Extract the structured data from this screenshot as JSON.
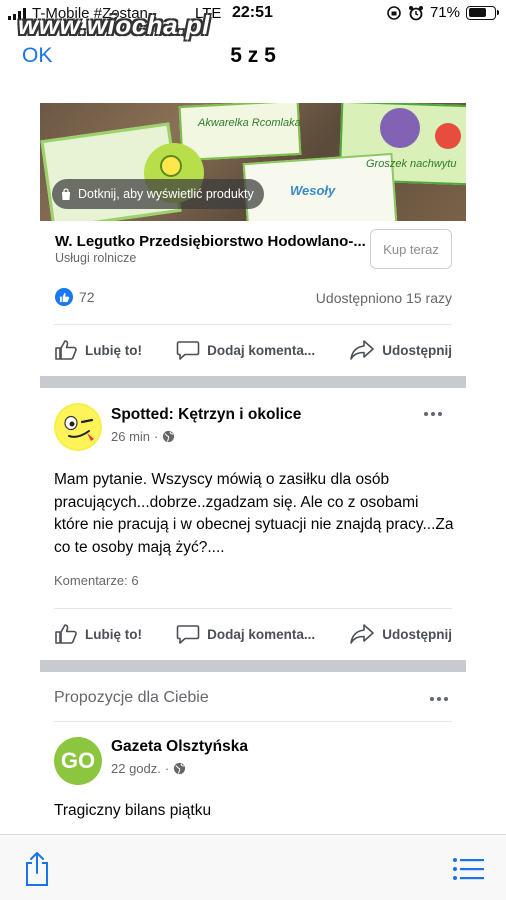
{
  "status": {
    "carrier": "T-Mobile #Zostan",
    "network": "LTE",
    "time": "22:51",
    "battery": "71%",
    "battery_level": 0.71
  },
  "watermark": "www.wiocha.pl",
  "nav": {
    "ok": "OK",
    "title": "5 z 5"
  },
  "ad": {
    "photo_pill": "Dotknij, aby wyświetlić produkty",
    "photo_texts": [
      "Akwarelka Rcomlaka",
      "Groszek nachwytu",
      "Wesoły"
    ],
    "title": "W. Legutko Przedsiębiorstwo Hodowlano-...",
    "subtitle": "Usługi rolnicze",
    "buy_label": "Kup teraz",
    "likes": "72",
    "shares": "Udostępniono 15 razy"
  },
  "actions": {
    "like": "Lubię to!",
    "comment": "Dodaj komenta...",
    "share": "Udostępnij"
  },
  "post": {
    "author": "Spotted: Kętrzyn i okolice",
    "time": "26 min",
    "text": "Mam pytanie. Wszyscy mówią o zasiłku dla osób pracujących...dobrze..zgadzam się. Ale co z osobami które nie pracują i w obecnej sytuacji nie znajdą pracy...Za co te osoby mają żyć?....",
    "comments": "Komentarze: 6"
  },
  "suggestions": {
    "heading": "Propozycje dla Ciebie",
    "author": "Gazeta Olsztyńska",
    "avatar_text": "GO",
    "time": "22 godz.",
    "text": "Tragiczny bilans piątku"
  },
  "colors": {
    "link": "#1a73e8",
    "fb_blue": "#1877f2",
    "go_green": "#8cc63f"
  }
}
